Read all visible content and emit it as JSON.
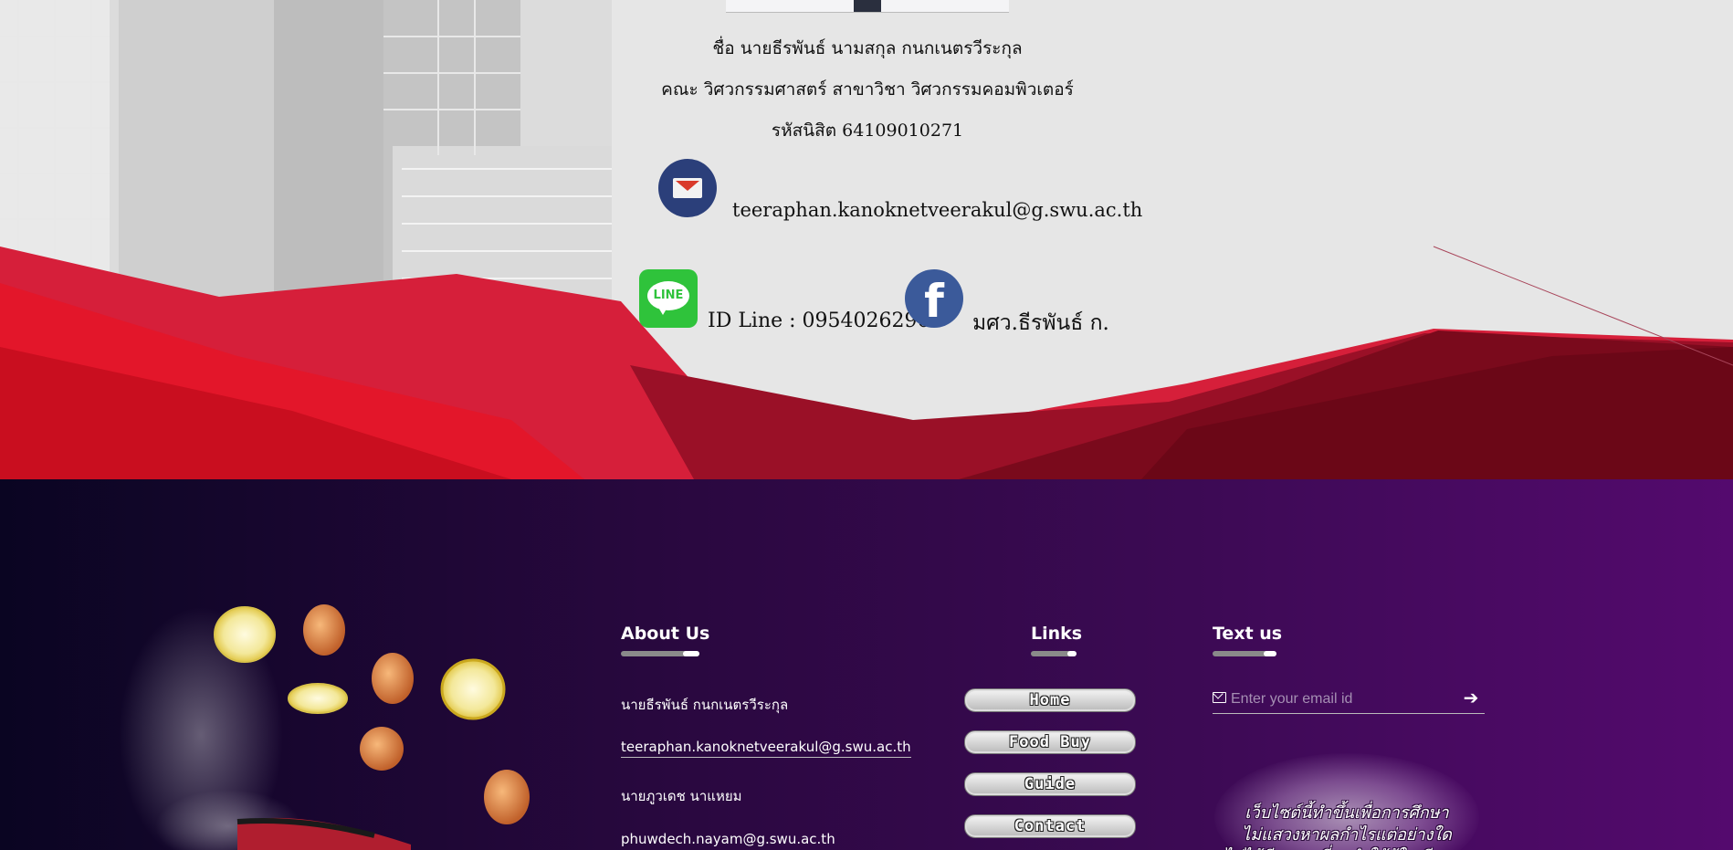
{
  "profile": {
    "name": "ชื่อ นายธีรพันธ์ นามสกุล กนกเนตรวีระกุล",
    "faculty": "คณะ วิศวกรรมศาสตร์ สาขาวิชา วิศวกรรมคอมพิวเตอร์",
    "student_id": "รหัสนิสิต 64109010271",
    "email": "teeraphan.kanoknetveerakul@g.swu.ac.th",
    "line_label": "ID Line : 0954026296",
    "line_icon_text": "LINE",
    "facebook_name": "มศว.ธีรพันธ์ ก.",
    "facebook_icon_text": "f"
  },
  "footer": {
    "about": {
      "title": "About Us",
      "items": [
        "นายธีรพันธ์ กนกเนตรวีระกุล",
        "teeraphan.kanoknetveerakul@g.swu.ac.th",
        "นายภูวเดช นาแหยม",
        "phuwdech.nayam@g.swu.ac.th"
      ]
    },
    "links": {
      "title": "Links",
      "buttons": [
        "Home",
        "Food Buy",
        "Guide",
        "Contact"
      ]
    },
    "text_us": {
      "title": "Text us",
      "placeholder": "Enter your email id",
      "arrow": "➔"
    },
    "notice_lines": [
      "เว็บไซต์นี้ทำขึ้นเพื่อการศึกษา",
      "ไม่แสวงหาผลกำไรแต่อย่างใด",
      "ไม่ได้มีเจตนาที่จะทำให้ผู้ใดเสียหาย"
    ]
  },
  "colors": {
    "footer_left": "#0a0522",
    "footer_right": "#540a6e",
    "line_green": "#2fc33b",
    "facebook_blue": "#3b5a9a",
    "gmail_navy": "#2b3f7a",
    "red_polygon": "#c8102e"
  },
  "icons": [
    "gmail-icon",
    "line-icon",
    "facebook-icon",
    "envelope-icon",
    "arrow-right-icon"
  ]
}
